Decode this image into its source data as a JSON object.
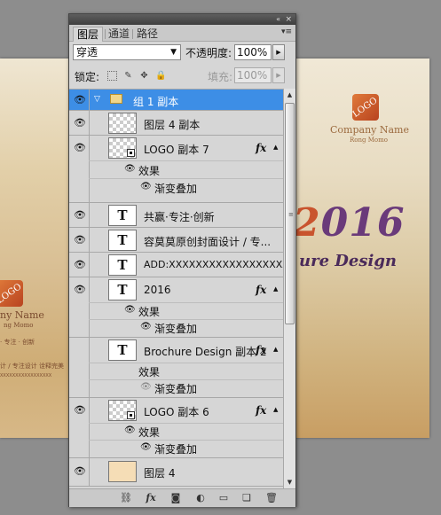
{
  "canvas": {
    "right_logo_text": "LOGO",
    "right_company": "Company Name",
    "right_subtitle": "Rong Momo",
    "year_prefix": "2",
    "year_rest": "016",
    "brochure": "ure Design",
    "left_logo_text": "LOGO",
    "left_company": "ny Name",
    "left_subtitle": "ng Momo",
    "left_tag": "· 专注 · 创新",
    "left_tag2": "计 / 专注设计 诠释完美",
    "left_tag3": "XXXXXXXXXXXXXXXXX"
  },
  "panel": {
    "collapse_icon": "«",
    "close_icon": "×",
    "tabs": [
      {
        "label": "图层"
      },
      {
        "label": "通道"
      },
      {
        "label": "路径"
      }
    ],
    "blend_mode": "穿透",
    "opacity_label": "不透明度:",
    "opacity_value": "100%",
    "lock_label": "锁定:",
    "fill_label": "填充:",
    "fill_value": "100%"
  },
  "layers": [
    {
      "name": "组 1 副本"
    },
    {
      "name": "图层 4 副本"
    },
    {
      "name": "LOGO 副本 7"
    },
    {
      "name": "共赢·专注·创新"
    },
    {
      "name": "容莫莫原创封面设计 / 专..."
    },
    {
      "name": "ADD:XXXXXXXXXXXXXXXXXX..."
    },
    {
      "name": "2016"
    },
    {
      "name": "Brochure Design 副本 2"
    },
    {
      "name": "LOGO 副本 6"
    },
    {
      "name": "图层 4"
    }
  ],
  "effects": {
    "effects_label": "效果",
    "gradient_label": "渐变叠加",
    "fx": "fx"
  },
  "icons": {
    "eye": "👁",
    "text_layer": "T",
    "folder": "folder-icon",
    "expand": "▼"
  }
}
